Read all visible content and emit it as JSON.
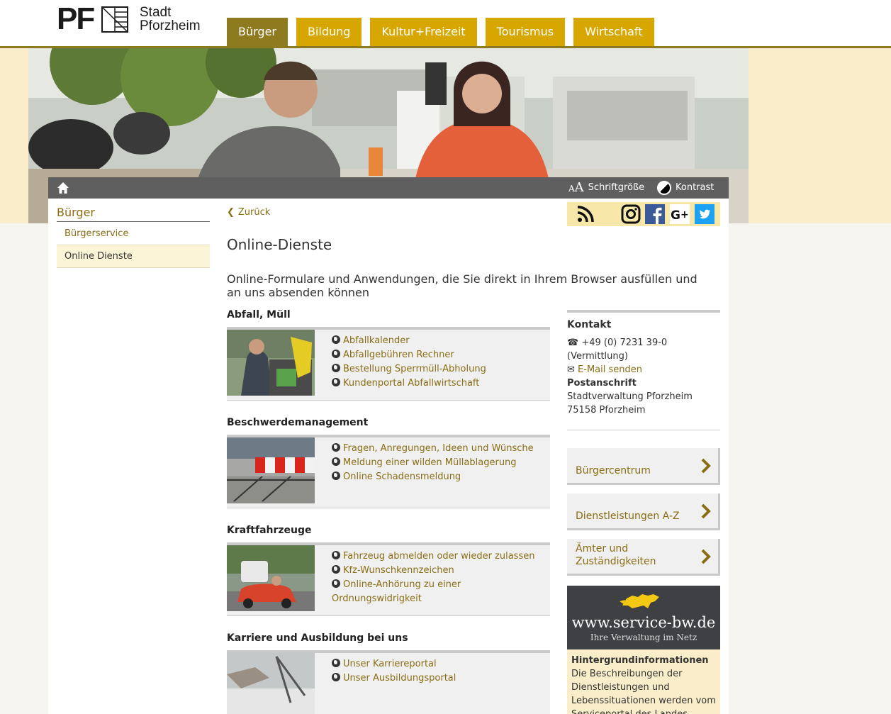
{
  "logo": {
    "mark": "PF",
    "line1": "Stadt",
    "line2": "Pforzheim"
  },
  "nav": [
    "Bürger",
    "Bildung",
    "Kultur+Freizeit",
    "Tourismus",
    "Wirtschaft"
  ],
  "toolbar": {
    "font_size_label": "Schriftgröße",
    "contrast_label": "Kontrast",
    "aa_small": "A",
    "aa_big": "A"
  },
  "sidebar": {
    "title": "Bürger",
    "items": [
      "Bürgerservice",
      "Online Dienste"
    ]
  },
  "back_label": "Zurück",
  "social_icons": [
    "rss-icon",
    "instagram-icon",
    "facebook-icon",
    "google-plus-icon",
    "twitter-icon"
  ],
  "page_title": "Online-Dienste",
  "lead": "Online-Formulare und Anwendungen, die Sie direkt in Ihrem Browser ausfüllen und an uns absenden können",
  "categories": [
    {
      "title": "Abfall, Müll",
      "links": [
        "Abfallkalender",
        "Abfallgebühren Rechner",
        "Bestellung Sperrmüll-Abholung",
        "Kundenportal Abfallwirtschaft"
      ]
    },
    {
      "title": "Beschwerdemanagement",
      "links": [
        "Fragen, Anregungen, Ideen und Wünsche",
        "Meldung einer wilden Müllablagerung",
        "Online Schadensmeldung"
      ]
    },
    {
      "title": "Kraftfahrzeuge",
      "links": [
        "Fahrzeug abmelden oder wieder zulassen",
        "Kfz-Wunschkennzeichen",
        "Online-Anhörung zu einer Ordnungswidrigkeit"
      ]
    },
    {
      "title": "Karriere und Ausbildung bei uns",
      "links": [
        "Unser Karriereportal",
        "Unser Ausbildungsportal"
      ]
    }
  ],
  "kontakt": {
    "title": "Kontakt",
    "phone": "+49 (0) 7231 39-0",
    "phone_note": "(Vermittlung)",
    "email_label": "E-Mail senden",
    "postanschrift_label": "Postanschrift",
    "address1": "Stadtverwaltung Pforzheim",
    "address2": "75158 Pforzheim"
  },
  "right_buttons": [
    "Bürgercentrum",
    "Dienstleistungen A-Z",
    "Ämter und Zuständigkeiten"
  ],
  "service_bw": {
    "url": "www.service-bw.de",
    "tagline": "Ihre Verwaltung im Netz",
    "info_title": "Hintergrundinformationen",
    "info_text": "Die Beschreibungen der Dienstleistungen und Lebenssituationen werden vom Serviceportal des Landes"
  },
  "colors": {
    "gold": "#d7a700",
    "dark_gold": "#8e7a1f",
    "link": "#8a6d13",
    "cream": "#f9eec9"
  }
}
